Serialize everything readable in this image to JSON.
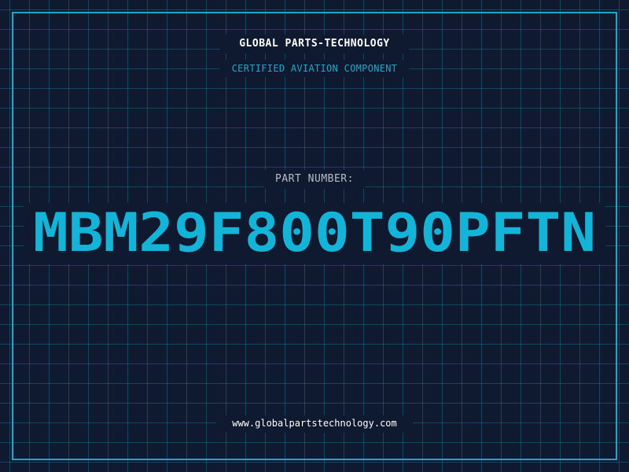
{
  "header": {
    "company": "GLOBAL PARTS-TECHNOLOGY",
    "subtitle": "CERTIFIED AVIATION COMPONENT"
  },
  "part": {
    "label": "PART NUMBER:",
    "number": "MBM29F800T90PFTN"
  },
  "footer": {
    "url": "www.globalpartstechnology.com"
  },
  "colors": {
    "background": "#0f1a30",
    "grid": "#1e7896",
    "accent": "#1fa7c9",
    "part_number": "#13b4d8",
    "label": "#b7bfcc",
    "text": "#ffffff"
  }
}
